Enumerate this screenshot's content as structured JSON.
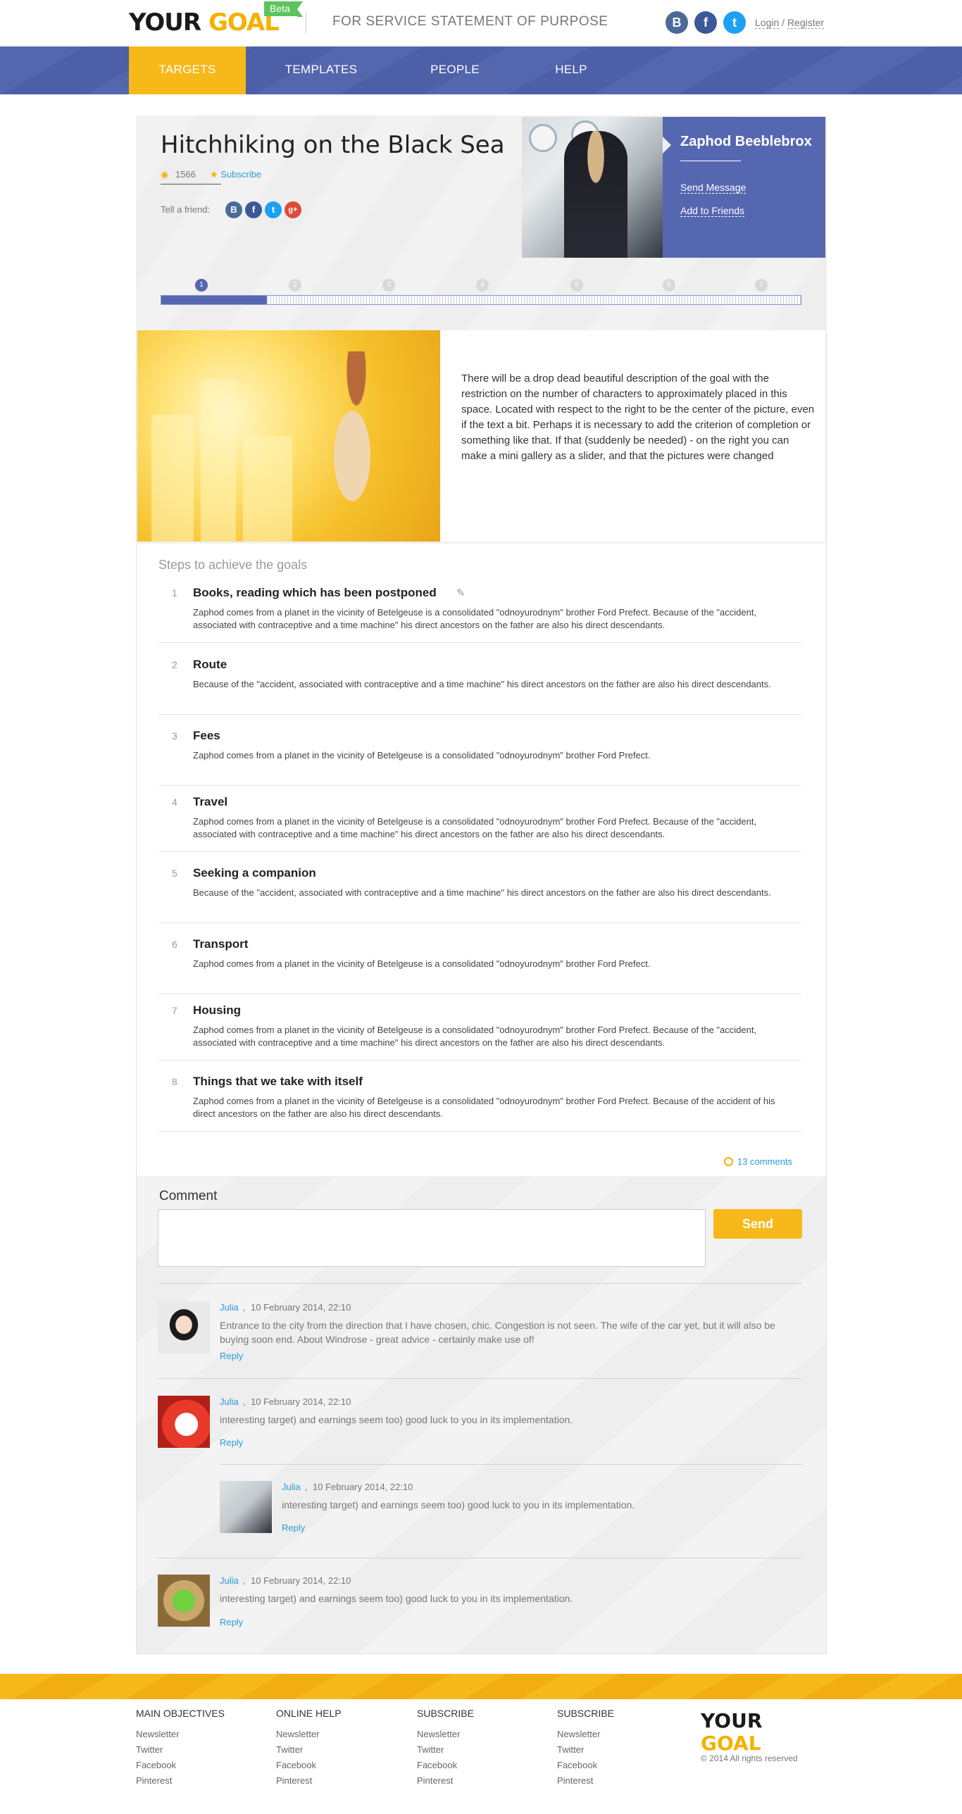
{
  "header": {
    "logo_your": "YOUR",
    "logo_goal": "GOAL",
    "beta": "Beta",
    "tagline": "FOR SERVICE STATEMENT OF PURPOSE",
    "social": [
      "B",
      "f",
      "t"
    ],
    "login": "Login",
    "sep": " / ",
    "register": "Register"
  },
  "nav": {
    "items": [
      "TARGETS",
      "TEMPLATES",
      "PEOPLE",
      "HELP"
    ],
    "active": "TARGETS"
  },
  "goal": {
    "title": "Hitchhiking on the Black Sea",
    "views": "1566",
    "subscribe": "Subscribe",
    "tell_friend": "Tell a friend:",
    "share": [
      "B",
      "f",
      "t",
      "g+"
    ]
  },
  "user": {
    "name": "Zaphod Beeblebrox",
    "send_message": "Send Message",
    "add_friends": "Add to Friends"
  },
  "progress": {
    "steps": [
      "1",
      "2",
      "3",
      "4",
      "5",
      "6",
      "7"
    ],
    "current": 1,
    "fraction": 0.165
  },
  "description": "There will be a drop dead beautiful description of the goal with the restriction on the number of characters to approximately placed in this space. Located with respect to the right to be the center of the picture, even if the text a bit. Perhaps it is necessary to add the criterion of completion or something like that. If that (suddenly be needed) - on the right you can make a mini gallery as a slider, and that the pictures were changed",
  "steps_heading": "Steps to achieve the goals",
  "steps": [
    {
      "num": "1",
      "title": "Books, reading which has been postponed",
      "desc": "Zaphod comes from a planet in the vicinity of Betelgeuse is a consolidated \"odnoyurodnym\" brother Ford Prefect. Because of the \"accident, associated with contraceptive and a time machine\" his direct ancestors on the father are also his direct descendants."
    },
    {
      "num": "2",
      "title": "Route",
      "desc": "Because of the \"accident, associated with contraceptive and a time machine\" his direct ancestors on the father are also his direct descendants."
    },
    {
      "num": "3",
      "title": "Fees",
      "desc": "Zaphod comes from a planet in the vicinity of Betelgeuse is a consolidated \"odnoyurodnym\" brother Ford Prefect."
    },
    {
      "num": "4",
      "title": "Travel",
      "desc": "Zaphod comes from a planet in the vicinity of Betelgeuse is a consolidated \"odnoyurodnym\" brother Ford Prefect. Because of the \"accident, associated with contraceptive and a time machine\" his direct ancestors on the father are also his direct descendants."
    },
    {
      "num": "5",
      "title": "Seeking a companion",
      "desc": "Because of the \"accident, associated with contraceptive and a time machine\" his direct ancestors on the father are also his direct descendants."
    },
    {
      "num": "6",
      "title": "Transport",
      "desc": "Zaphod comes from a planet in the vicinity of Betelgeuse is a consolidated \"odnoyurodnym\" brother Ford Prefect."
    },
    {
      "num": "7",
      "title": "Housing",
      "desc": "Zaphod comes from a planet in the vicinity of Betelgeuse is a consolidated \"odnoyurodnym\" brother Ford Prefect. Because of the \"accident, associated with contraceptive and a time machine\" his direct ancestors on the father are also his direct descendants."
    },
    {
      "num": "8",
      "title": "Things that we take with itself",
      "desc": "Zaphod comes from a planet in the vicinity of Betelgeuse is a consolidated \"odnoyurodnym\" brother Ford Prefect. Because of the accident of his direct ancestors on the father are also his direct descendants."
    }
  ],
  "comments_link": "13 comments",
  "comment_form": {
    "label": "Comment",
    "value": "",
    "send": "Send"
  },
  "comments": [
    {
      "author": "Julia",
      "comma": ",",
      "date": "10 February 2014, 22:10",
      "text": "Entrance to the city from the direction that I have chosen, chic. Congestion is not seen. The wife of the car yet, but it will also be buying soon end. About Windrose - great advice - certainly make use of!",
      "reply": "Reply"
    },
    {
      "author": "Julia",
      "comma": ",",
      "date": "10 February 2014, 22:10",
      "text": "interesting target) and earnings seem too) good luck to you in its implementation.",
      "reply": "Reply"
    },
    {
      "author": "Julia",
      "comma": ",",
      "date": "10 February 2014, 22:10",
      "text": "interesting target) and earnings seem too) good luck to you in its implementation.",
      "reply": "Reply"
    },
    {
      "author": "Julia",
      "comma": ",",
      "date": "10 February 2014, 22:10",
      "text": "interesting target) and earnings seem too) good luck to you in its implementation.",
      "reply": "Reply"
    }
  ],
  "footer": {
    "columns": [
      {
        "heading": "MAIN OBJECTIVES",
        "links": [
          "Newsletter",
          "Twitter",
          "Facebook",
          "Pinterest"
        ]
      },
      {
        "heading": "ONLINE HELP",
        "links": [
          "Newsletter",
          "Twitter",
          "Facebook",
          "Pinterest"
        ]
      },
      {
        "heading": "SUBSCRIBE",
        "links": [
          "Newsletter",
          "Twitter",
          "Facebook",
          "Pinterest"
        ]
      },
      {
        "heading": "SUBSCRIBE",
        "links": [
          "Newsletter",
          "Twitter",
          "Facebook",
          "Pinterest"
        ]
      }
    ],
    "logo_your": "YOUR",
    "logo_goal": "GOAL",
    "copyright": "© 2014 All rights reserved"
  },
  "colors": {
    "accent": "#f7b81a",
    "brand_blue": "#5667b1",
    "link": "#2a9bdd"
  }
}
